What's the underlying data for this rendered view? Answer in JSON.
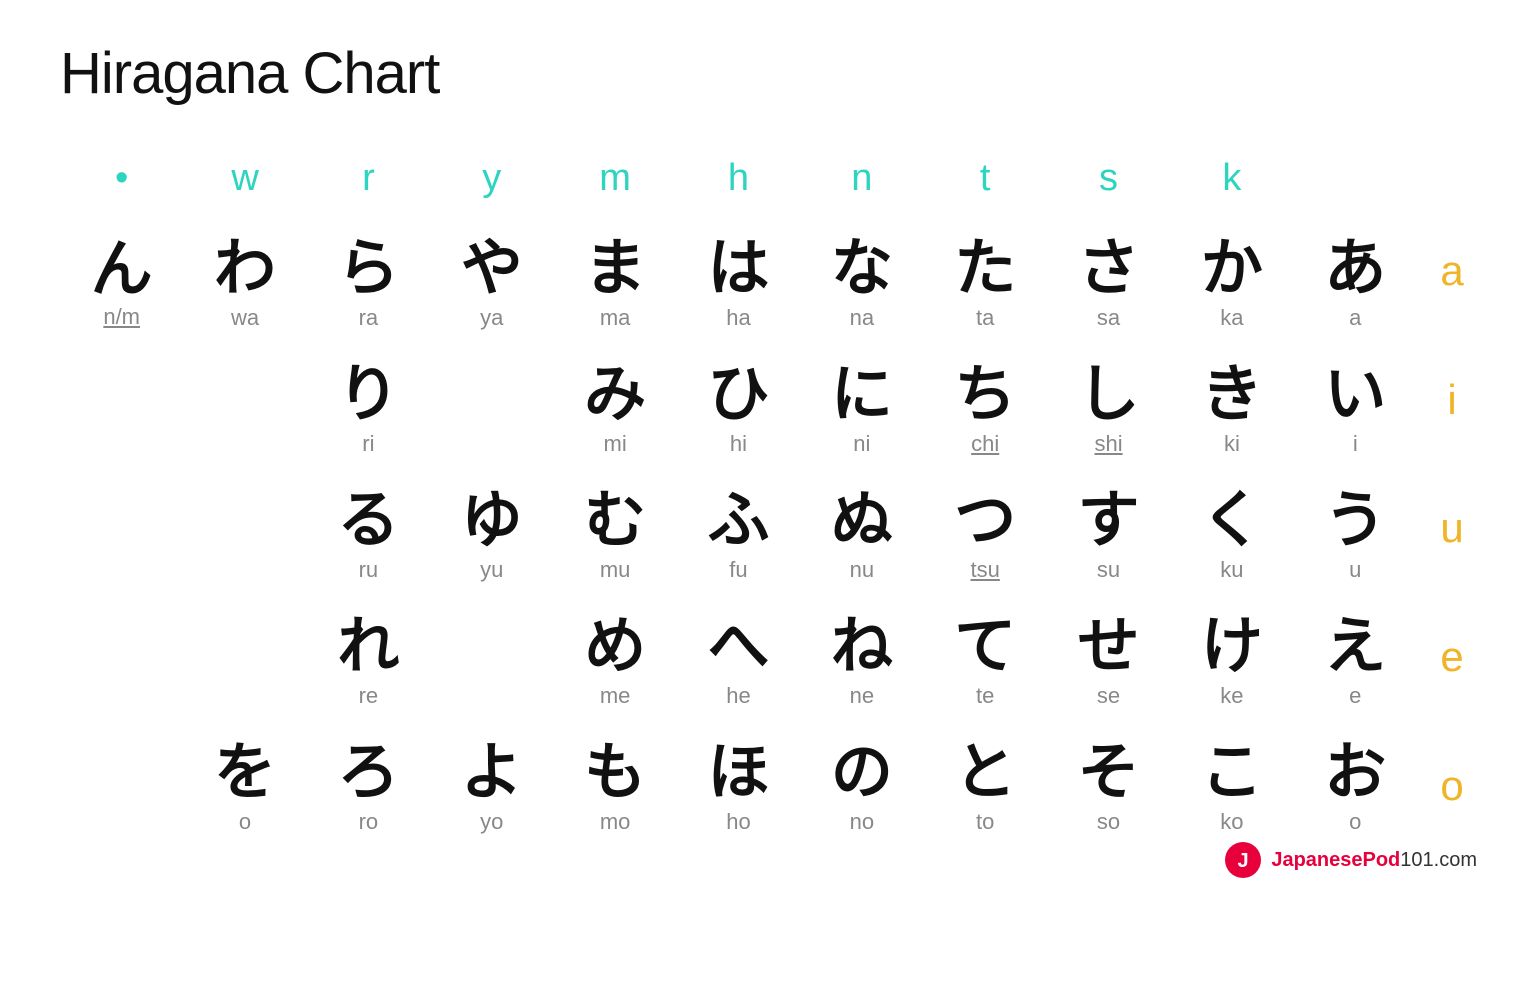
{
  "title": "Hiragana Chart",
  "header": {
    "cols": [
      "•",
      "w",
      "r",
      "y",
      "m",
      "h",
      "n",
      "t",
      "s",
      "k",
      ""
    ]
  },
  "vowel_labels": [
    "a",
    "i",
    "u",
    "e",
    "o"
  ],
  "rows": [
    {
      "vowel": "a",
      "cells": [
        {
          "kana": "ん",
          "romaji": "n/m",
          "underline": true
        },
        {
          "kana": "わ",
          "romaji": "wa"
        },
        {
          "kana": "ら",
          "romaji": "ra"
        },
        {
          "kana": "や",
          "romaji": "ya"
        },
        {
          "kana": "ま",
          "romaji": "ma"
        },
        {
          "kana": "は",
          "romaji": "ha"
        },
        {
          "kana": "な",
          "romaji": "na"
        },
        {
          "kana": "た",
          "romaji": "ta"
        },
        {
          "kana": "さ",
          "romaji": "sa"
        },
        {
          "kana": "か",
          "romaji": "ka"
        },
        {
          "kana": "あ",
          "romaji": "a"
        }
      ]
    },
    {
      "vowel": "i",
      "cells": [
        {
          "kana": "",
          "romaji": ""
        },
        {
          "kana": "",
          "romaji": ""
        },
        {
          "kana": "り",
          "romaji": "ri"
        },
        {
          "kana": "",
          "romaji": ""
        },
        {
          "kana": "み",
          "romaji": "mi"
        },
        {
          "kana": "ひ",
          "romaji": "hi"
        },
        {
          "kana": "に",
          "romaji": "ni"
        },
        {
          "kana": "ち",
          "romaji": "chi",
          "underline": true
        },
        {
          "kana": "し",
          "romaji": "shi",
          "underline": true
        },
        {
          "kana": "き",
          "romaji": "ki"
        },
        {
          "kana": "い",
          "romaji": "i"
        }
      ]
    },
    {
      "vowel": "u",
      "cells": [
        {
          "kana": "",
          "romaji": ""
        },
        {
          "kana": "",
          "romaji": ""
        },
        {
          "kana": "る",
          "romaji": "ru"
        },
        {
          "kana": "ゆ",
          "romaji": "yu"
        },
        {
          "kana": "む",
          "romaji": "mu"
        },
        {
          "kana": "ふ",
          "romaji": "fu"
        },
        {
          "kana": "ぬ",
          "romaji": "nu"
        },
        {
          "kana": "つ",
          "romaji": "tsu",
          "underline": true
        },
        {
          "kana": "す",
          "romaji": "su"
        },
        {
          "kana": "く",
          "romaji": "ku"
        },
        {
          "kana": "う",
          "romaji": "u"
        }
      ]
    },
    {
      "vowel": "e",
      "cells": [
        {
          "kana": "",
          "romaji": ""
        },
        {
          "kana": "",
          "romaji": ""
        },
        {
          "kana": "れ",
          "romaji": "re"
        },
        {
          "kana": "",
          "romaji": ""
        },
        {
          "kana": "め",
          "romaji": "me"
        },
        {
          "kana": "へ",
          "romaji": "he"
        },
        {
          "kana": "ね",
          "romaji": "ne"
        },
        {
          "kana": "て",
          "romaji": "te"
        },
        {
          "kana": "せ",
          "romaji": "se"
        },
        {
          "kana": "け",
          "romaji": "ke"
        },
        {
          "kana": "え",
          "romaji": "e"
        }
      ]
    },
    {
      "vowel": "o",
      "cells": [
        {
          "kana": "",
          "romaji": ""
        },
        {
          "kana": "を",
          "romaji": "o"
        },
        {
          "kana": "ろ",
          "romaji": "ro"
        },
        {
          "kana": "よ",
          "romaji": "yo"
        },
        {
          "kana": "も",
          "romaji": "mo"
        },
        {
          "kana": "ほ",
          "romaji": "ho"
        },
        {
          "kana": "の",
          "romaji": "no"
        },
        {
          "kana": "と",
          "romaji": "to"
        },
        {
          "kana": "そ",
          "romaji": "so"
        },
        {
          "kana": "こ",
          "romaji": "ko"
        },
        {
          "kana": "お",
          "romaji": "o"
        }
      ]
    }
  ],
  "logo": {
    "text": "JapanesePod101.com"
  }
}
